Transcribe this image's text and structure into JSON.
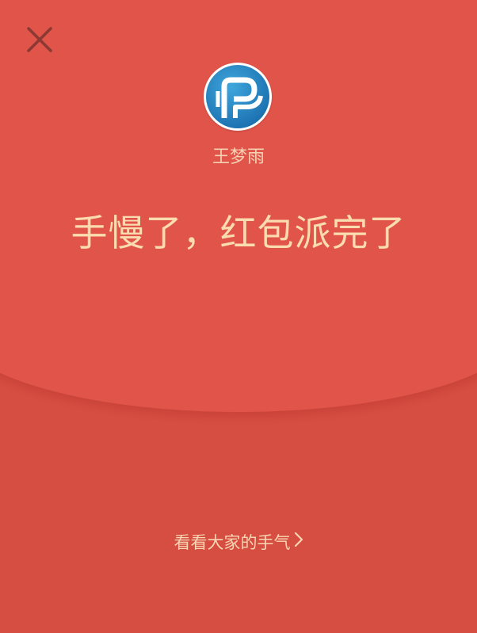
{
  "colors": {
    "background_bottom": "#d64d41",
    "background_top": "#e0544a",
    "text_gold": "#fbdcb0",
    "close_icon": "#8a3a32"
  },
  "header": {
    "close_icon": "close-icon"
  },
  "sender": {
    "avatar_icon": "company-logo-avatar",
    "name": "王梦雨"
  },
  "main": {
    "status_text": "手慢了，红包派完了"
  },
  "footer": {
    "luck_link_label": "看看大家的手气",
    "luck_link_icon": "chevron-right-icon"
  }
}
